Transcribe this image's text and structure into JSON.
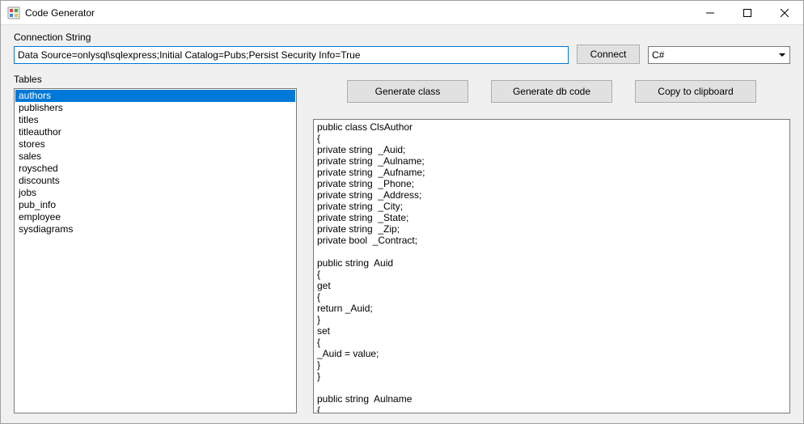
{
  "window": {
    "title": "Code Generator"
  },
  "labels": {
    "connection": "Connection String",
    "tables": "Tables"
  },
  "connection": {
    "value": "Data Source=onlysql\\sqlexpress;Initial Catalog=Pubs;Persist Security Info=True"
  },
  "buttons": {
    "connect": "Connect",
    "generate_class": "Generate class",
    "generate_db": "Generate db code",
    "copy": "Copy to clipboard"
  },
  "language": {
    "selected": "C#",
    "options": [
      "C#"
    ]
  },
  "tables": {
    "selected_index": 0,
    "items": [
      "authors",
      "publishers",
      "titles",
      "titleauthor",
      "stores",
      "sales",
      "roysched",
      "discounts",
      "jobs",
      "pub_info",
      "employee",
      "sysdiagrams"
    ]
  },
  "code": "public class ClsAuthor\n{\nprivate string  _Auid;\nprivate string  _Aulname;\nprivate string  _Aufname;\nprivate string  _Phone;\nprivate string  _Address;\nprivate string  _City;\nprivate string  _State;\nprivate string  _Zip;\nprivate bool  _Contract;\n\npublic string  Auid\n{\nget\n{\nreturn _Auid;\n}\nset\n{\n_Auid = value;\n}\n}\n\npublic string  Aulname\n{"
}
